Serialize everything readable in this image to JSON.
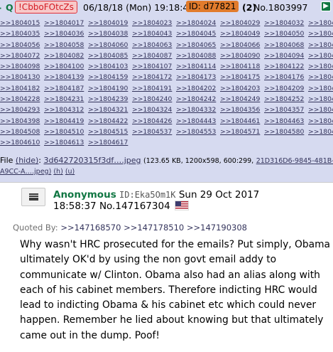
{
  "header": {
    "name": "Q",
    "tripcode": "!CbboFOtcZs",
    "datetime": "06/18/18 (Mon) 19:18:48",
    "id": "ID: d77821",
    "reply_count": "(2)",
    "post_no": "No.1803997",
    "toggle": "▶"
  },
  "backlinks": [
    ">>1804015",
    ">>1804017",
    ">>1804019",
    ">>1804023",
    ">>1804024",
    ">>1804029",
    ">>1804032",
    ">>1804033",
    ">>1804035",
    ">>1804036",
    ">>1804038",
    ">>1804043",
    ">>1804045",
    ">>1804049",
    ">>1804050",
    ">>1804052",
    ">>1804056",
    ">>1804058",
    ">>1804060",
    ">>1804063",
    ">>1804065",
    ">>1804066",
    ">>1804068",
    ">>1804070",
    ">>1804072",
    ">>1804082",
    ">>1804085",
    ">>1804087",
    ">>1804088",
    ">>1804090",
    ">>1804094",
    ">>1804097",
    ">>1804098",
    ">>1804100",
    ">>1804103",
    ">>1804107",
    ">>1804114",
    ">>1804118",
    ">>1804122",
    ">>1804126",
    ">>1804130",
    ">>1804139",
    ">>1804159",
    ">>1804172",
    ">>1804173",
    ">>1804175",
    ">>1804176",
    ">>1804178",
    ">>1804182",
    ">>1804187",
    ">>1804190",
    ">>1804191",
    ">>1804202",
    ">>1804203",
    ">>1804209",
    ">>1804223",
    ">>1804228",
    ">>1804231",
    ">>1804239",
    ">>1804240",
    ">>1804242",
    ">>1804249",
    ">>1804252",
    ">>1804276",
    ">>1804293",
    ">>1804312",
    ">>1804321",
    ">>1804324",
    ">>1804332",
    ">>1804356",
    ">>1804357",
    ">>1804380",
    ">>1804398",
    ">>1804419",
    ">>1804422",
    ">>1804426",
    ">>1804443",
    ">>1804461",
    ">>1804463",
    ">>1804490",
    ">>1804508",
    ">>1804510",
    ">>1804515",
    ">>1804537",
    ">>1804553",
    ">>1804571",
    ">>1804580",
    ">>1804594",
    ">>1804610",
    ">>1804613",
    ">>1804617"
  ],
  "file": {
    "label": "File",
    "hide": "(hide)",
    "name": "3d642720315f3df….jpeg",
    "meta": "(123.65 KB, 1200x598, 600:299,",
    "orig": "21D316D6-9845-481B-",
    "orig2": "A9CC-A….jpeg)",
    "h": "(h)",
    "u": "(u)"
  },
  "post": {
    "name": "Anonymous",
    "id": "ID:Eka5Om1K",
    "date": "Sun 29 Oct 2017",
    "time": "18:58:37",
    "no": "No.147167304",
    "quoted_label": "Quoted By:",
    "quoted": [
      ">>147168570",
      ">>147178510",
      ">>147190308"
    ],
    "body": "Why wasn't HRC prosecuted for the emails? Put simply, Obama ultimately OK'd by using the non govt email addy to communicate w/ Clinton. Obama also had an alias along with each of his cabinet members. Therefore indicting HRC would lead to indicting Obama & his cabinet etc which could never happen. Remember he lied about knowing but that ultimately came out in the dump. Poof!"
  }
}
